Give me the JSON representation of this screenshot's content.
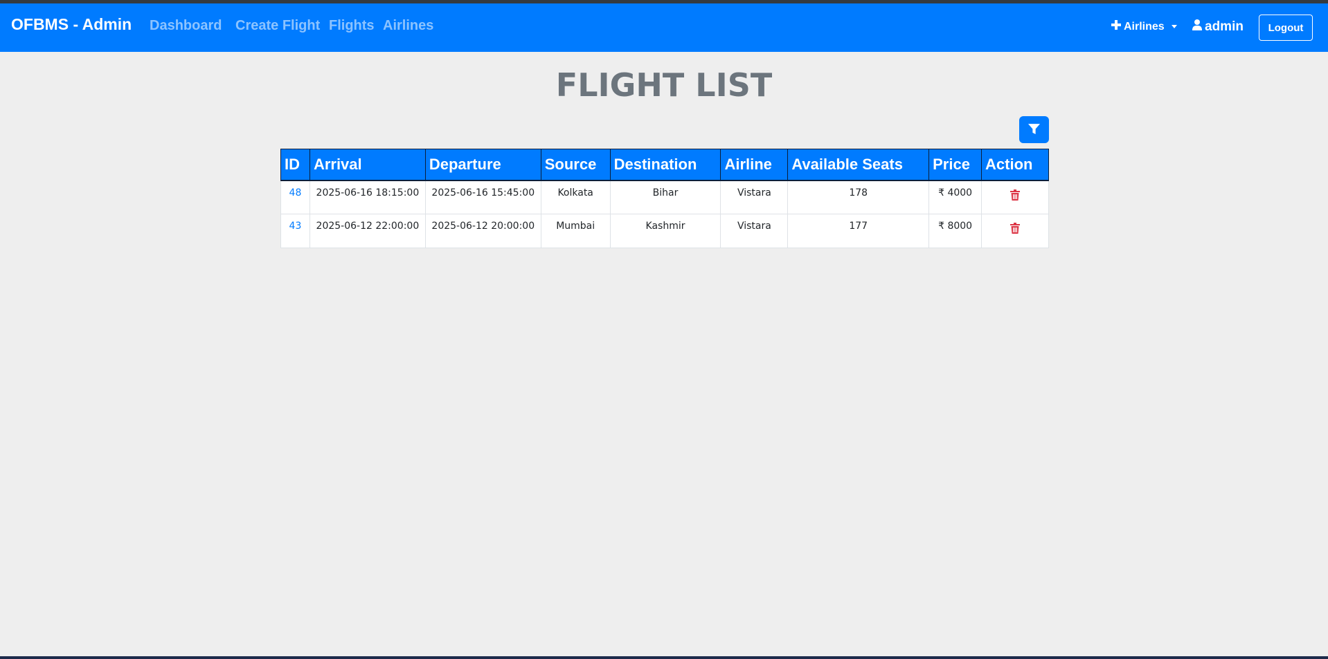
{
  "navbar": {
    "brand": "OFBMS - Admin",
    "links": [
      "Dashboard",
      "Create Flight",
      "Flights",
      "Airlines"
    ],
    "airlines_dropdown": "Airlines",
    "user": "admin",
    "logout": "Logout"
  },
  "page": {
    "title": "FLIGHT LIST"
  },
  "table": {
    "headers": [
      "ID",
      "Arrival",
      "Departure",
      "Source",
      "Destination",
      "Airline",
      "Available Seats",
      "Price",
      "Action"
    ],
    "rows": [
      {
        "id": "48",
        "arrival": "2025-06-16 18:15:00",
        "departure": "2025-06-16 15:45:00",
        "source": "Kolkata",
        "destination": "Bihar",
        "airline": "Vistara",
        "seats": "178",
        "price": "4000"
      },
      {
        "id": "43",
        "arrival": "2025-06-12 22:00:00",
        "departure": "2025-06-12 20:00:00",
        "source": "Mumbai",
        "destination": "Kashmir",
        "airline": "Vistara",
        "seats": "177",
        "price": "8000"
      }
    ]
  },
  "currency_symbol": "₹",
  "icons": {
    "filter": "filter-icon",
    "delete": "trash-icon",
    "plus": "plus-icon",
    "user": "user-icon",
    "caret": "caret-down-icon"
  },
  "colors": {
    "primary": "#007bff",
    "danger": "#dc3545",
    "background": "#eeeeee",
    "title": "#6c757d"
  }
}
